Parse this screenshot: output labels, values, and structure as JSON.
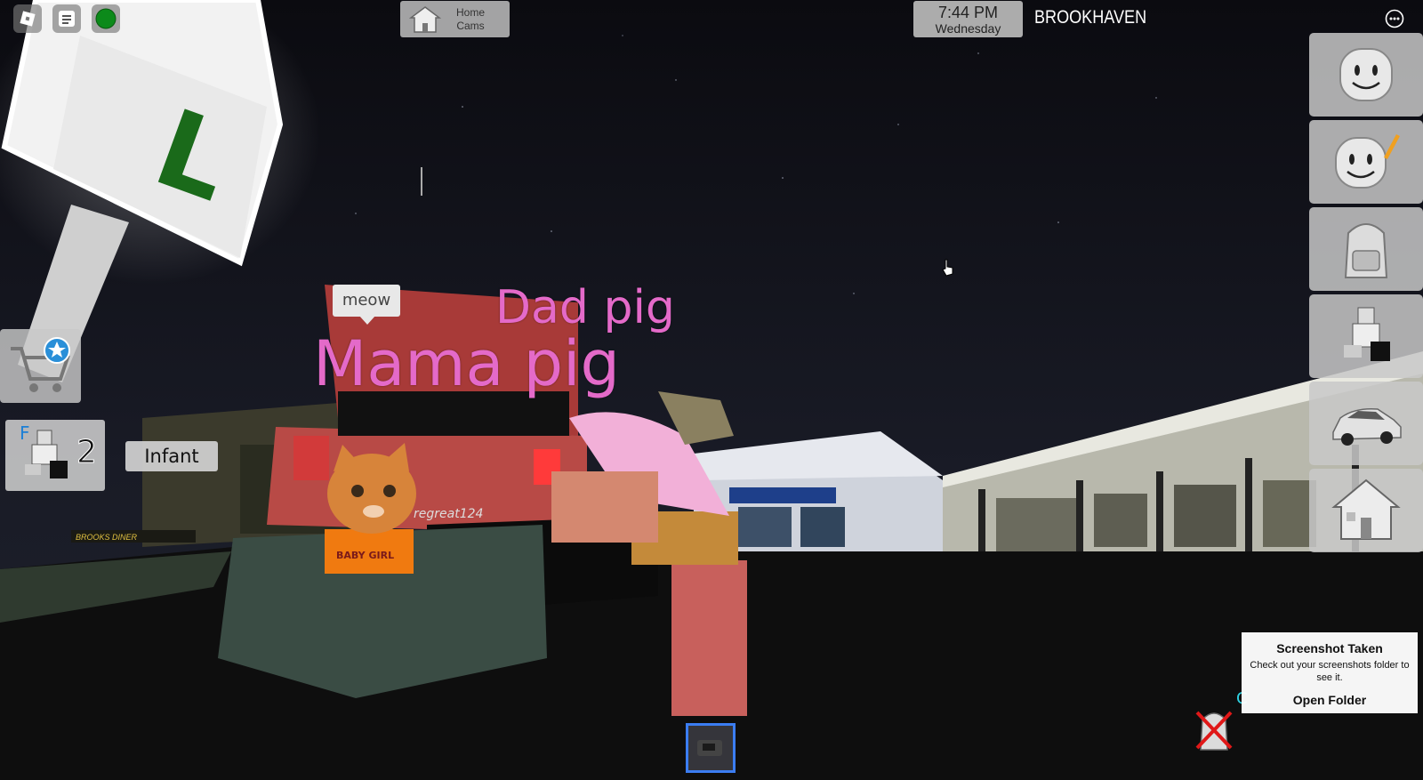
{
  "hud": {
    "home_cams_label_1": "Home",
    "home_cams_label_2": "Cams",
    "clock_time": "7:44 PM",
    "clock_day": "Wednesday",
    "place_name": "BROOKHAVEN",
    "family_key": "F",
    "family_count": "2",
    "role_label": "Infant",
    "backpack_key": "C"
  },
  "world": {
    "nametag_dad": "Dad pig",
    "nametag_mama": "Mama pig",
    "chat_bubble": "meow",
    "player_name_partial": "regreat124",
    "sign_letter": "L",
    "diner_sign": "BROOKS DINER",
    "shirt_text": "BABY GIRL"
  },
  "toast": {
    "title": "Screenshot Taken",
    "body": "Check out your screenshots folder to see it.",
    "button": "Open Folder"
  },
  "side_menu": [
    {
      "icon": "avatar-face-icon"
    },
    {
      "icon": "avatar-edit-icon"
    },
    {
      "icon": "backpack-icon"
    },
    {
      "icon": "roleplay-icon"
    },
    {
      "icon": "car-icon"
    },
    {
      "icon": "house-icon"
    }
  ],
  "colors": {
    "nametag_pink": "#e46ac9",
    "hotbar_selected": "#3b7df2",
    "key_cyan": "#2ed3e3"
  }
}
